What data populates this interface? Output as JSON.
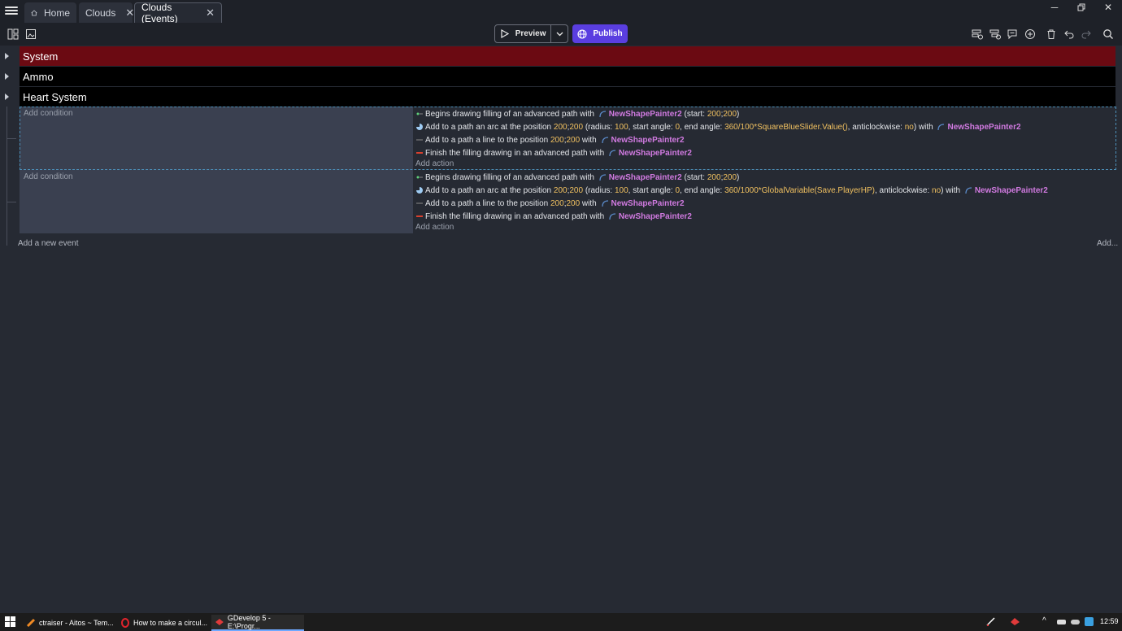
{
  "tabs": [
    {
      "label": "Home"
    },
    {
      "label": "Clouds"
    },
    {
      "label": "Clouds (Events)"
    }
  ],
  "toolbar": {
    "preview_label": "Preview",
    "publish_label": "Publish"
  },
  "groups": [
    {
      "label": "System",
      "color": "#6b0a12"
    },
    {
      "label": "Ammo",
      "color": "#000000"
    },
    {
      "label": "Heart System",
      "color": "#000000"
    }
  ],
  "events": [
    {
      "add_condition": "Add condition",
      "add_action": "Add action",
      "actions": [
        {
          "parts": [
            {
              "t": "Begins drawing filling of an advanced path with "
            },
            {
              "o": "NewShapePainter2"
            },
            {
              "t": " (start: "
            },
            {
              "n": "200"
            },
            {
              "t": ";"
            },
            {
              "n": "200"
            },
            {
              "t": ")"
            }
          ]
        },
        {
          "parts": [
            {
              "t": "Add to a path an arc at the position "
            },
            {
              "n": "200"
            },
            {
              "t": ";"
            },
            {
              "n": "200"
            },
            {
              "t": " (radius: "
            },
            {
              "n": "100"
            },
            {
              "t": ", start angle: "
            },
            {
              "n": "0"
            },
            {
              "t": ", end angle: "
            },
            {
              "n": "360/100*SquareBlueSlider.Value()"
            },
            {
              "t": ", anticlockwise: "
            },
            {
              "n": "no"
            },
            {
              "t": ") with "
            },
            {
              "o": "NewShapePainter2"
            }
          ]
        },
        {
          "parts": [
            {
              "t": "Add to a path a line to the position "
            },
            {
              "n": "200"
            },
            {
              "t": ";"
            },
            {
              "n": "200"
            },
            {
              "t": " with "
            },
            {
              "o": "NewShapePainter2"
            }
          ]
        },
        {
          "parts": [
            {
              "t": "Finish the filling drawing in an advanced path with "
            },
            {
              "o": "NewShapePainter2"
            }
          ]
        }
      ]
    },
    {
      "add_condition": "Add condition",
      "add_action": "Add action",
      "actions": [
        {
          "parts": [
            {
              "t": "Begins drawing filling of an advanced path with "
            },
            {
              "o": "NewShapePainter2"
            },
            {
              "t": " (start: "
            },
            {
              "n": "200"
            },
            {
              "t": ";"
            },
            {
              "n": "200"
            },
            {
              "t": ")"
            }
          ]
        },
        {
          "parts": [
            {
              "t": "Add to a path an arc at the position "
            },
            {
              "n": "200"
            },
            {
              "t": ";"
            },
            {
              "n": "200"
            },
            {
              "t": " (radius: "
            },
            {
              "n": "100"
            },
            {
              "t": ", start angle: "
            },
            {
              "n": "0"
            },
            {
              "t": ", end angle: "
            },
            {
              "n": "360/1000*GlobalVariable(Save.PlayerHP)"
            },
            {
              "t": ", anticlockwise: "
            },
            {
              "n": "no"
            },
            {
              "t": ") with "
            },
            {
              "o": "NewShapePainter2"
            }
          ]
        },
        {
          "parts": [
            {
              "t": "Add to a path a line to the position "
            },
            {
              "n": "200"
            },
            {
              "t": ";"
            },
            {
              "n": "200"
            },
            {
              "t": " with "
            },
            {
              "o": "NewShapePainter2"
            }
          ]
        },
        {
          "parts": [
            {
              "t": "Finish the filling drawing in an advanced path with "
            },
            {
              "o": "NewShapePainter2"
            }
          ]
        }
      ]
    }
  ],
  "footer": {
    "add_event": "Add a new event",
    "add_more": "Add..."
  },
  "taskbar": {
    "items": [
      {
        "label": "ctraiser - Aitos ~ Tem..."
      },
      {
        "label": "How to make a circul..."
      },
      {
        "label": "GDevelop 5 - E:\\Progr..."
      }
    ],
    "clock": "12:59"
  }
}
